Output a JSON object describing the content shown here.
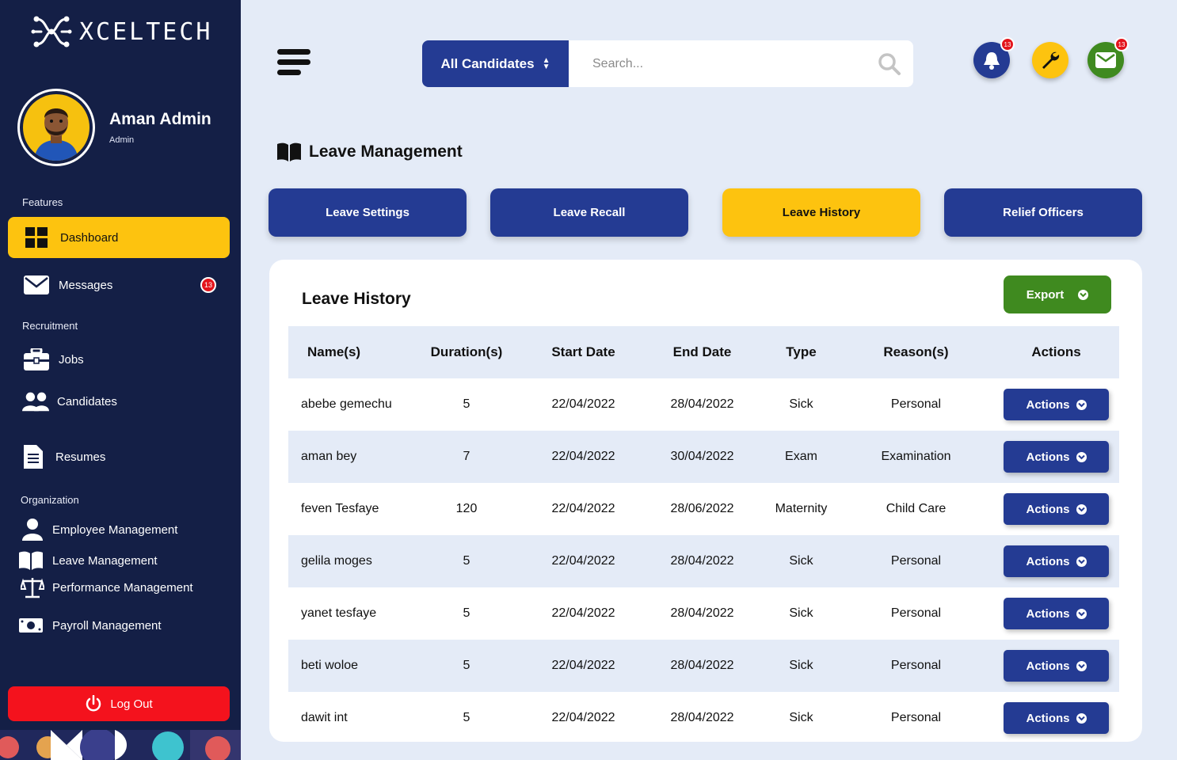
{
  "brand": {
    "name": "XCELTECH"
  },
  "profile": {
    "name": "Aman Admin",
    "role": "Admin"
  },
  "sidebar": {
    "sections": {
      "features": "Features",
      "recruitment": "Recruitment",
      "organization": "Organization"
    },
    "items": [
      {
        "label": "Dashboard",
        "icon": "dashboard-icon",
        "active": true
      },
      {
        "label": "Messages",
        "icon": "envelope-icon",
        "badge": "13"
      },
      {
        "label": "Jobs",
        "icon": "briefcase-icon"
      },
      {
        "label": "Candidates",
        "icon": "users-icon"
      },
      {
        "label": "Resumes",
        "icon": "document-icon"
      },
      {
        "label": "Employee Management",
        "icon": "user-icon"
      },
      {
        "label": "Leave Management",
        "icon": "book-icon"
      },
      {
        "label": "Performance Management",
        "icon": "scale-icon"
      },
      {
        "label": "Payroll Management",
        "icon": "money-icon"
      }
    ],
    "logout": "Log Out"
  },
  "search": {
    "filter": "All Candidates",
    "placeholder": "Search..."
  },
  "top_icons": {
    "notifications_badge": "13",
    "messages_badge": "13"
  },
  "page": {
    "title": "Leave Management"
  },
  "tabs": [
    {
      "label": "Leave Settings"
    },
    {
      "label": "Leave Recall"
    },
    {
      "label": "Leave History",
      "active": true
    },
    {
      "label": "Relief Officers"
    }
  ],
  "card": {
    "title": "Leave History",
    "export": "Export",
    "columns": [
      "Name(s)",
      "Duration(s)",
      "Start Date",
      "End Date",
      "Type",
      "Reason(s)",
      "Actions"
    ],
    "action_label": "Actions",
    "rows": [
      {
        "name": "abebe gemechu",
        "duration": "5",
        "start": "22/04/2022",
        "end": "28/04/2022",
        "type": "Sick",
        "reason": "Personal"
      },
      {
        "name": "aman bey",
        "duration": "7",
        "start": "22/04/2022",
        "end": "30/04/2022",
        "type": "Exam",
        "reason": "Examination"
      },
      {
        "name": "feven Tesfaye",
        "duration": "120",
        "start": "22/04/2022",
        "end": "28/06/2022",
        "type": "Maternity",
        "reason": "Child Care"
      },
      {
        "name": "gelila moges",
        "duration": "5",
        "start": "22/04/2022",
        "end": "28/04/2022",
        "type": "Sick",
        "reason": "Personal"
      },
      {
        "name": "yanet tesfaye",
        "duration": "5",
        "start": "22/04/2022",
        "end": "28/04/2022",
        "type": "Sick",
        "reason": "Personal"
      },
      {
        "name": "beti woloe",
        "duration": "5",
        "start": "22/04/2022",
        "end": "28/04/2022",
        "type": "Sick",
        "reason": "Personal"
      },
      {
        "name": "dawit int",
        "duration": "5",
        "start": "22/04/2022",
        "end": "28/04/2022",
        "type": "Sick",
        "reason": "Personal"
      }
    ]
  },
  "colors": {
    "sidebar": "#141f46",
    "accent": "#fdc30f",
    "primary": "#243b93",
    "export": "#3f8a1f",
    "logout": "#f4121d",
    "background": "#e4ebf7"
  }
}
